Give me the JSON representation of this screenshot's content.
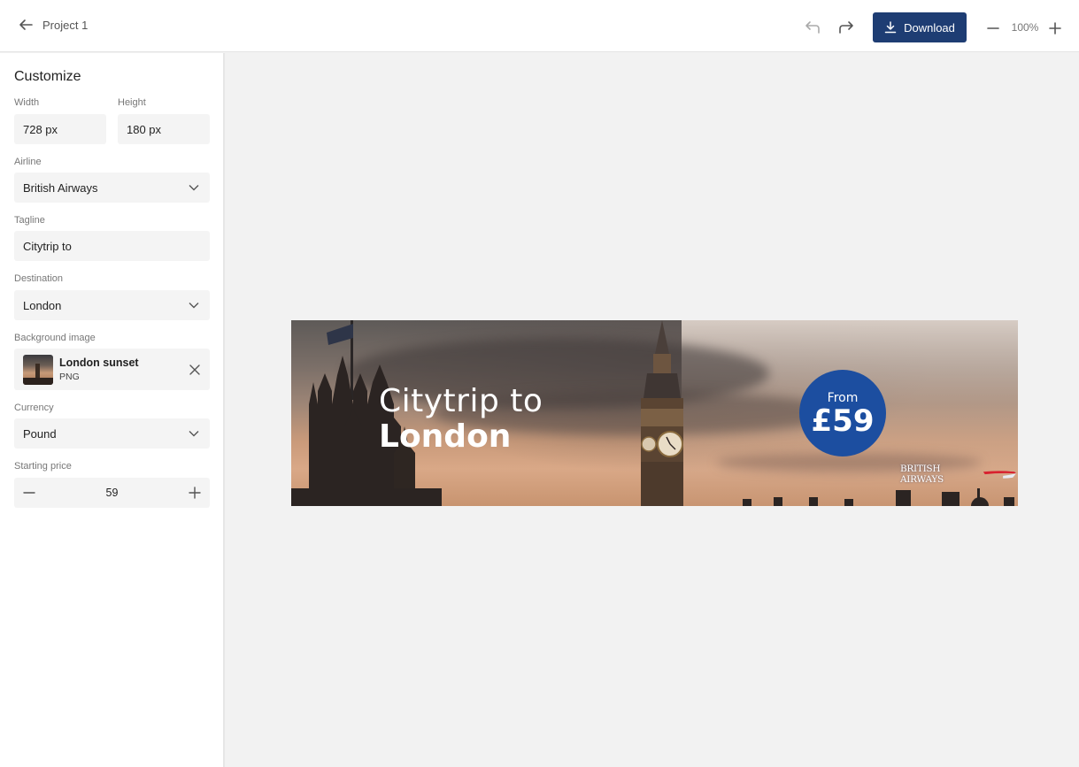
{
  "header": {
    "back_label": "Project 1",
    "download_label": "Download",
    "zoom_level": "100%"
  },
  "colors": {
    "accent": "#1e3d73",
    "badge": "#1c4ea0",
    "field_bg": "#f4f4f4",
    "canvas_bg": "#f2f2f2"
  },
  "sidebar": {
    "title": "Customize",
    "width": {
      "label": "Width",
      "value": "728 px"
    },
    "height": {
      "label": "Height",
      "value": "180 px"
    },
    "airline": {
      "label": "Airline",
      "value": "British Airways"
    },
    "tagline": {
      "label": "Tagline",
      "value": "Citytrip to"
    },
    "destination": {
      "label": "Destination",
      "value": "London"
    },
    "background_image": {
      "label": "Background image",
      "name": "London sunset",
      "type": "PNG"
    },
    "currency": {
      "label": "Currency",
      "value": "Pound"
    },
    "starting_price": {
      "label": "Starting price",
      "value": "59"
    }
  },
  "banner": {
    "tagline": "Citytrip to",
    "destination": "London",
    "price_prefix": "From",
    "price": "£59",
    "airline_logo_text": "BRITISH AIRWAYS"
  }
}
